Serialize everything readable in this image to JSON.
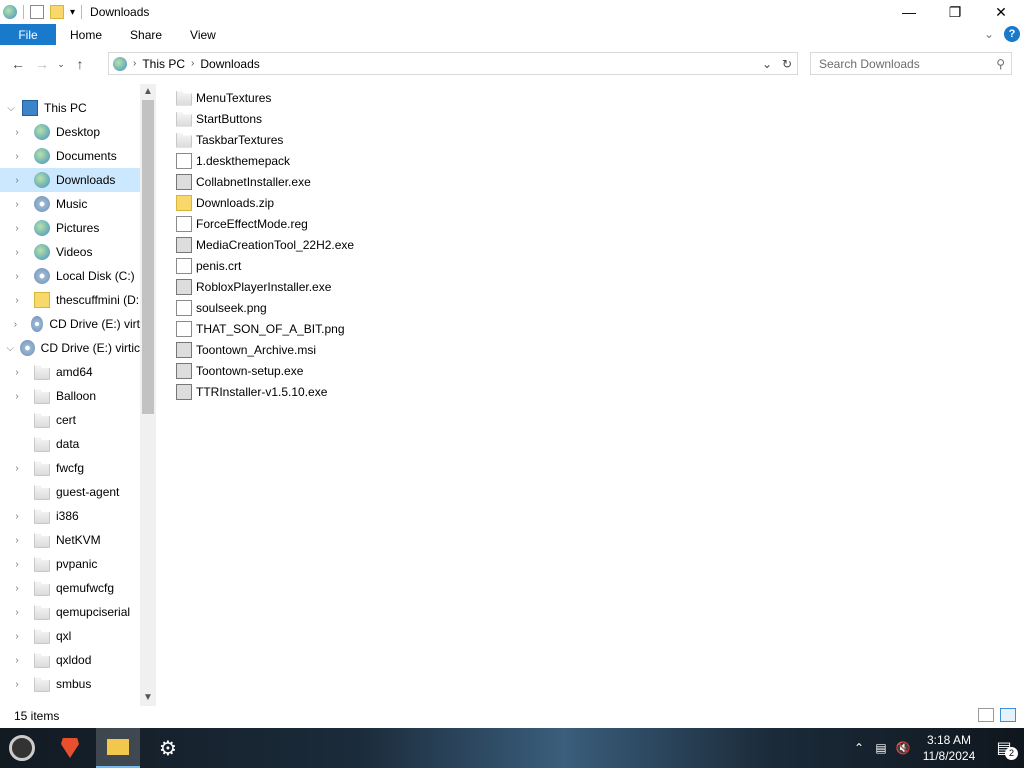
{
  "window": {
    "title": "Downloads"
  },
  "ribbon": {
    "tabs": [
      "File",
      "Home",
      "Share",
      "View"
    ]
  },
  "address": {
    "crumbs": [
      "This PC",
      "Downloads"
    ]
  },
  "search": {
    "placeholder": "Search Downloads"
  },
  "nav": [
    {
      "label": "This PC",
      "indent": 0,
      "expanded": true,
      "icon": "pc-icon"
    },
    {
      "label": "Desktop",
      "indent": 1,
      "icon": "desktop-icon"
    },
    {
      "label": "Documents",
      "indent": 1,
      "icon": "documents-icon"
    },
    {
      "label": "Downloads",
      "indent": 1,
      "icon": "downloads-icon",
      "selected": true
    },
    {
      "label": "Music",
      "indent": 1,
      "icon": "music-icon"
    },
    {
      "label": "Pictures",
      "indent": 1,
      "icon": "pictures-icon"
    },
    {
      "label": "Videos",
      "indent": 1,
      "icon": "videos-icon"
    },
    {
      "label": "Local Disk (C:)",
      "indent": 1,
      "icon": "disk-icon"
    },
    {
      "label": "thescuffmini (D:",
      "indent": 1,
      "icon": "usb-icon"
    },
    {
      "label": "CD Drive (E:) virt",
      "indent": 1,
      "icon": "cd-icon"
    },
    {
      "label": "CD Drive (E:) virtic",
      "indent": 0,
      "expanded": true,
      "icon": "cd-icon"
    },
    {
      "label": "amd64",
      "indent": 1,
      "icon": "folder-icon",
      "hasChildren": true
    },
    {
      "label": "Balloon",
      "indent": 1,
      "icon": "folder-icon",
      "hasChildren": true
    },
    {
      "label": "cert",
      "indent": 1,
      "icon": "folder-icon"
    },
    {
      "label": "data",
      "indent": 1,
      "icon": "folder-icon"
    },
    {
      "label": "fwcfg",
      "indent": 1,
      "icon": "folder-icon",
      "hasChildren": true
    },
    {
      "label": "guest-agent",
      "indent": 1,
      "icon": "folder-icon"
    },
    {
      "label": "i386",
      "indent": 1,
      "icon": "folder-icon",
      "hasChildren": true
    },
    {
      "label": "NetKVM",
      "indent": 1,
      "icon": "folder-icon",
      "hasChildren": true
    },
    {
      "label": "pvpanic",
      "indent": 1,
      "icon": "folder-icon",
      "hasChildren": true
    },
    {
      "label": "qemufwcfg",
      "indent": 1,
      "icon": "folder-icon",
      "hasChildren": true
    },
    {
      "label": "qemupciserial",
      "indent": 1,
      "icon": "folder-icon",
      "hasChildren": true
    },
    {
      "label": "qxl",
      "indent": 1,
      "icon": "folder-icon",
      "hasChildren": true
    },
    {
      "label": "qxldod",
      "indent": 1,
      "icon": "folder-icon",
      "hasChildren": true
    },
    {
      "label": "smbus",
      "indent": 1,
      "icon": "folder-icon",
      "hasChildren": true
    }
  ],
  "files": [
    {
      "name": "MenuTextures",
      "icon": "folder-icon"
    },
    {
      "name": "StartButtons",
      "icon": "folder-icon"
    },
    {
      "name": "TaskbarTextures",
      "icon": "folder-icon"
    },
    {
      "name": "1.deskthemepack",
      "icon": "themepack-icon"
    },
    {
      "name": "CollabnetInstaller.exe",
      "icon": "exe-icon"
    },
    {
      "name": "Downloads.zip",
      "icon": "zip-icon"
    },
    {
      "name": "ForceEffectMode.reg",
      "icon": "reg-icon"
    },
    {
      "name": "MediaCreationTool_22H2.exe",
      "icon": "exe-icon"
    },
    {
      "name": "penis.crt",
      "icon": "certificate-icon"
    },
    {
      "name": "RobloxPlayerInstaller.exe",
      "icon": "exe-icon"
    },
    {
      "name": "soulseek.png",
      "icon": "image-icon"
    },
    {
      "name": "THAT_SON_OF_A_BIT.png",
      "icon": "image-icon"
    },
    {
      "name": "Toontown_Archive.msi",
      "icon": "msi-icon"
    },
    {
      "name": "Toontown-setup.exe",
      "icon": "exe-icon"
    },
    {
      "name": "TTRInstaller-v1.5.10.exe",
      "icon": "exe-icon"
    }
  ],
  "status": {
    "item_count": "15 items"
  },
  "taskbar": {
    "time": "3:18 AM",
    "date": "11/8/2024",
    "notification_count": "2"
  }
}
